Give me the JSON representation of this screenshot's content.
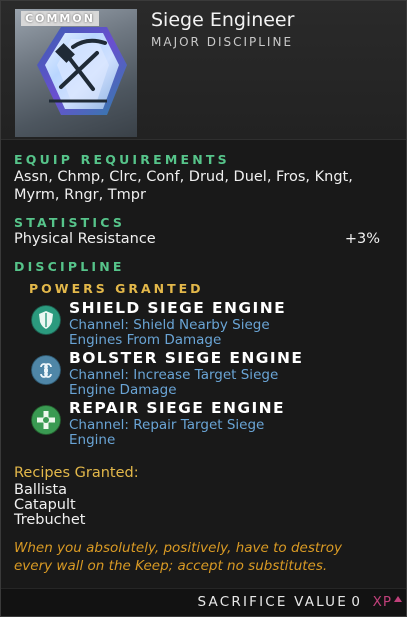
{
  "item": {
    "rarity": "COMMON",
    "title": "Siege Engineer",
    "subtitle": "MAJOR DISCIPLINE",
    "icon": "pickaxe-hammer-icon"
  },
  "equip": {
    "heading": "EQUIP REQUIREMENTS",
    "line1": "Assn, Chmp, Clrc, Conf, Drud, Duel, Fros, Kngt,",
    "line2": "Myrm, Rngr, Tmpr"
  },
  "stats": {
    "heading": "STATISTICS",
    "items": [
      {
        "name": "Physical Resistance",
        "value": "+3%"
      }
    ]
  },
  "discipline": {
    "heading": "DISCIPLINE",
    "powers_heading": "POWERS GRANTED",
    "powers": [
      {
        "name": "SHIELD SIEGE ENGINE",
        "desc_line1": "Channel: Shield Nearby Siege",
        "desc_line2": "Engines From Damage",
        "icon": "shield-icon",
        "color": "#2b9a7e"
      },
      {
        "name": "BOLSTER SIEGE ENGINE",
        "desc_line1": "Channel: Increase Target Siege",
        "desc_line2": "Engine Damage",
        "icon": "swirl-icon",
        "color": "#4f86a7"
      },
      {
        "name": "REPAIR SIEGE ENGINE",
        "desc_line1": "Channel: Repair Target Siege",
        "desc_line2": "Engine",
        "icon": "repair-icon",
        "color": "#3a9a52"
      }
    ]
  },
  "recipes": {
    "heading": "Recipes Granted:",
    "items": [
      "Ballista",
      "Catapult",
      "Trebuchet"
    ]
  },
  "flavor": {
    "line1": "When you absolutely, positively, have to destroy",
    "line2": "every wall on the Keep; accept no substitutes."
  },
  "footer": {
    "sacrifice_label": "SACRIFICE VALUE",
    "sacrifice_value": "0",
    "currency": "XP"
  },
  "colors": {
    "section_green": "#56c48a",
    "gold": "#e3b84a",
    "desc_blue": "#6aa5d6",
    "flavor_orange": "#d99a24",
    "xp_pink": "#c0407a"
  }
}
